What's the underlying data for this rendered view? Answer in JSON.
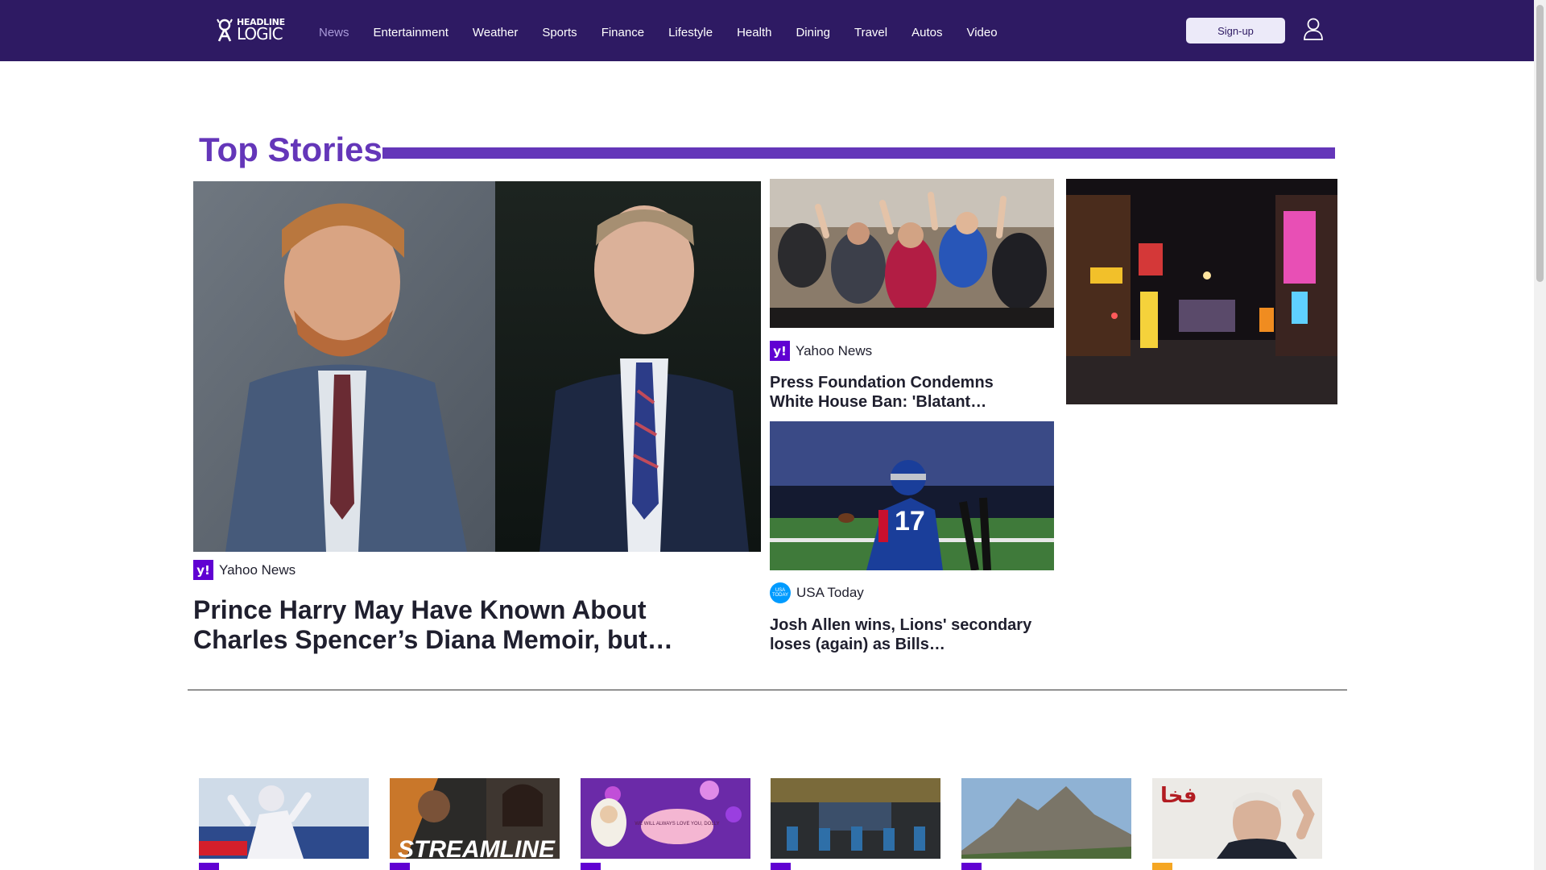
{
  "header": {
    "logo_line1": "HEADLINE",
    "logo_line2": "LOGIC",
    "nav": [
      {
        "label": "News",
        "active": true
      },
      {
        "label": "Entertainment",
        "active": false
      },
      {
        "label": "Weather",
        "active": false
      },
      {
        "label": "Sports",
        "active": false
      },
      {
        "label": "Finance",
        "active": false
      },
      {
        "label": "Lifestyle",
        "active": false
      },
      {
        "label": "Health",
        "active": false
      },
      {
        "label": "Dining",
        "active": false
      },
      {
        "label": "Travel",
        "active": false
      },
      {
        "label": "Autos",
        "active": false
      },
      {
        "label": "Video",
        "active": false
      }
    ],
    "signup_label": "Sign-up",
    "user_icon": "user-icon"
  },
  "section": {
    "title": "Top Stories"
  },
  "stories": {
    "main": {
      "source": "Yahoo News",
      "source_badge": "y!",
      "headline": "Prince Harry May Have Known About Charles Spencer’s Diana Memoir, but…"
    },
    "second": {
      "source": "Yahoo News",
      "source_badge": "y!",
      "headline": "Press Foundation Condemns White House Ban: 'Blatant…"
    },
    "third": {
      "source": "USA Today",
      "source_badge": "USA TODAY",
      "headline": "Josh Allen wins, Lions' secondary loses (again) as Bills…"
    }
  },
  "thumb_text": {
    "streamline": "STREAMLINE",
    "dolly": "WE WILL ALWAYS LOVE YOU, DOLLY",
    "arabic": "فخا"
  },
  "colors": {
    "header_bg": "#2e1a63",
    "accent": "#6436b9",
    "yahoo": "#6001d2",
    "usa_today": "#009bff"
  }
}
